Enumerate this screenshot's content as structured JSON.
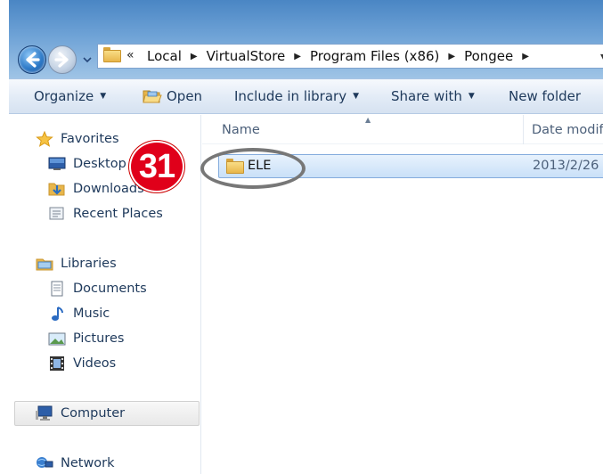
{
  "address": {
    "overflow_chevrons": "«",
    "crumbs": [
      "Local",
      "VirtualStore",
      "Program Files (x86)",
      "Pongee"
    ]
  },
  "toolbar": {
    "organize_label": "Organize",
    "open_label": "Open",
    "include_label": "Include in library",
    "share_label": "Share with",
    "new_folder_label": "New folder"
  },
  "nav": {
    "favorites_label": "Favorites",
    "desktop_label": "Desktop",
    "downloads_label": "Downloads",
    "recent_label": "Recent Places",
    "libraries_label": "Libraries",
    "documents_label": "Documents",
    "music_label": "Music",
    "pictures_label": "Pictures",
    "videos_label": "Videos",
    "computer_label": "Computer",
    "network_label": "Network"
  },
  "columns": {
    "name": "Name",
    "date": "Date modif"
  },
  "files": [
    {
      "name": "ELE",
      "date": "2013/2/26"
    }
  ],
  "annotation": {
    "step_number": "31"
  },
  "colors": {
    "accent": "#2c79c7",
    "badge": "#e0001a",
    "selection": "#c9e0f8"
  }
}
